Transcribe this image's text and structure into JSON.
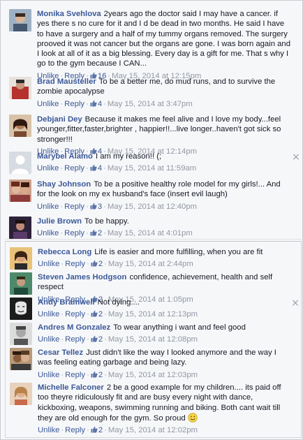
{
  "ui": {
    "unlike_label": "Unlike",
    "reply_label": "Reply",
    "separator": "·"
  },
  "comments": [
    {
      "author": "Monika Svehlova",
      "text": "2years ago the doctor said I may have a cancer. if yes there s no cure for it and I d be dead in two months. He said I have to have a surgery and a half of my tummy organs removed. The surgery prooved it was not cancer but the organs are gone. I was born again and I look at all of it as a big blessing. Every day is a gift for me. That s why I go to the gym because I CAN...",
      "likes": "16",
      "timestamp": "May 15, 2014 at 12:15pm",
      "avatar_color": "#6b7c8f"
    },
    {
      "author": "Brad Mausteller",
      "text": "To be a better me, do mud runs, and to survive the zombie apocalypse",
      "likes": "4",
      "timestamp": "May 15, 2014 at 3:47pm",
      "avatar_color": "#b5322d"
    },
    {
      "author": "Debjani Dey",
      "text": "Because it makes me feel alive and I love my body...feel younger,fitter,faster,brighter , happier!!...live longer..haven't got sick so stronger!!!",
      "likes": "4",
      "timestamp": "May 15, 2014 at 12:14pm",
      "avatar_color": "#7a4a2e"
    },
    {
      "author": "Marybel Alamo",
      "text": "I am my reason!! (;",
      "likes": "4",
      "timestamp": "May 15, 2014 at 11:59am",
      "avatar_color": "#c7cbd1"
    },
    {
      "author": "Shay Johnson",
      "text": "To be a positive healthy role model for my girls!... And for the look on my ex husband's face (insert evil laugh)",
      "likes": "3",
      "timestamp": "May 15, 2014 at 12:40pm",
      "avatar_color": "#8e3b3b"
    },
    {
      "author": "Julie Brown",
      "text": "To be happy.",
      "likes": "2",
      "timestamp": "May 15, 2014 at 4:01pm",
      "avatar_color": "#4a3a5a"
    },
    {
      "author": "Rebecca Long",
      "text": "Life is easier and more fulfilling, when you are fit",
      "likes": "2",
      "timestamp": "May 15, 2014 at 2:44pm",
      "avatar_color": "#c99a3a"
    },
    {
      "author": "Steven James Hodgson",
      "text": "confidence, achievement, health and self respect",
      "likes": "2",
      "timestamp": "May 15, 2014 at 1:05pm",
      "avatar_color": "#3f7a5a"
    },
    {
      "author": "Andy Bramwell",
      "text": "Not dying....",
      "likes": "2",
      "timestamp": "May 15, 2014 at 12:13pm",
      "avatar_color": "#222222"
    },
    {
      "author": "Andres M Gonzalez",
      "text": "To wear anything i want and feel good",
      "likes": "2",
      "timestamp": "May 15, 2014 at 12:08pm",
      "avatar_color": "#5a5a5a"
    },
    {
      "author": "Cesar Tellez",
      "text": "Just didn't like the way I looked anymore and the way I was feeling eating garbage and being lazy.",
      "likes": "2",
      "timestamp": "May 15, 2014 at 12:03pm",
      "avatar_color": "#7a5a3a"
    },
    {
      "author": "Michelle Falconer",
      "text": "2 be a good example for my children.... its paid off too theyre ridiculously fit and are busy every night with dance, kickboxing, weapons, swimming running and biking. Both cant wait till they are old enough for the gym. So proud",
      "likes": "2",
      "timestamp": "May 15, 2014 at 12:02pm",
      "avatar_color": "#c98a5a"
    }
  ]
}
